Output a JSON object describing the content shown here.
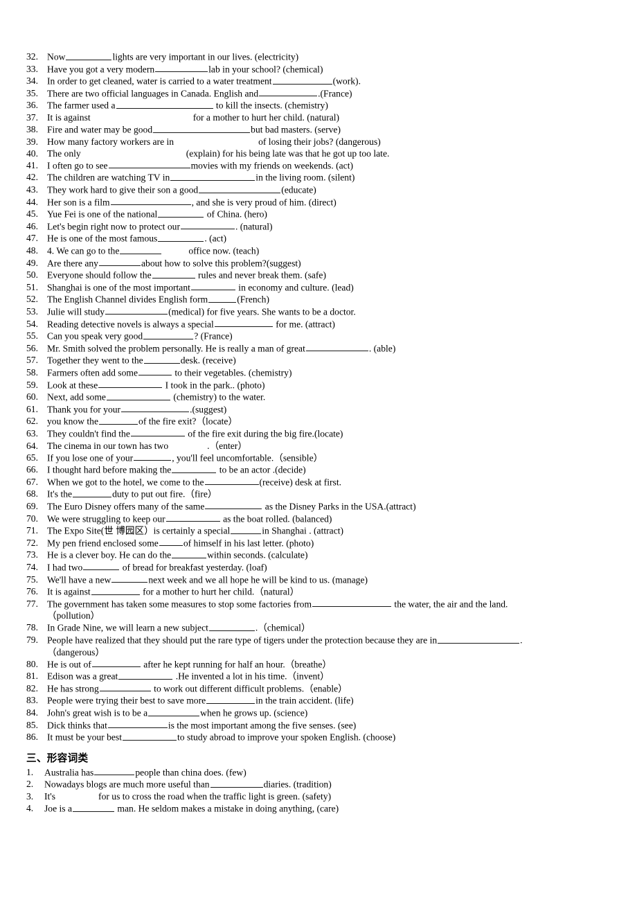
{
  "document": {
    "type": "worksheet",
    "language": "en-zh",
    "page_background": "#ffffff",
    "text_color": "#000000"
  },
  "exercises": [
    {
      "num": "32.",
      "pre": "Now",
      "blank": 66,
      "post": "lights are very important in our lives. (electricity)"
    },
    {
      "num": "33.",
      "pre": "Have you got a very modern",
      "blank": 76,
      "post": "lab in your school? (chemical)"
    },
    {
      "num": "34.",
      "pre": "In order to get cleaned, water is carried to a water treatment",
      "blank": 86,
      "post": "(work)."
    },
    {
      "num": "35.",
      "pre": "There are two official languages in Canada. English and",
      "blank": 84,
      "post": ".(France)"
    },
    {
      "num": "36.",
      "pre": "The farmer used a",
      "blank": 140,
      "post": " to kill the insects. (chemistry)"
    },
    {
      "num": "37.",
      "pre": "It is against",
      "blank": 0,
      "gap": 148,
      "post": "for a mother to hurt her child. (natural)"
    },
    {
      "num": "38.",
      "pre": "Fire and water may be good",
      "blank": 140,
      "post": "but bad masters. (serve)"
    },
    {
      "num": "39.",
      "pre": "How many factory workers are in",
      "blank": 0,
      "gap": 122,
      "post": "of losing their jobs? (dangerous)"
    },
    {
      "num": "40.",
      "pre": "The only",
      "blank": 0,
      "gap": 152,
      "post": "(explain) for his being late was that he got up too late."
    },
    {
      "num": "41.",
      "pre": "I often go to see",
      "blank": 118,
      "post": "movies with my friends on weekends. (act)"
    },
    {
      "num": "42.",
      "pre": "The children are watching TV in",
      "blank": 122,
      "post": "in the living room. (silent)"
    },
    {
      "num": "43.",
      "pre": "They work hard to give their son a good",
      "blank": 118,
      "post": "(educate)"
    },
    {
      "num": "44.",
      "pre": "Her son is a film",
      "blank": 116,
      "post": ", and she is very proud of him. (direct)"
    },
    {
      "num": "45.",
      "pre": "Yue Fei is one of the national",
      "blank": 66,
      "post": " of China. (hero)"
    },
    {
      "num": "46.",
      "pre": "Let's begin right now to protect our",
      "blank": 78,
      "post": ". (natural)"
    },
    {
      "num": "47.",
      "pre": "He is one of the most famous",
      "blank": 66,
      "post": ". (act)"
    },
    {
      "num": "48.",
      "pre": "4. We can go to the",
      "blank": 60,
      "gap": 38,
      "post": "office now. (teach)"
    },
    {
      "num": "49.",
      "pre": "Are there any",
      "blank": 60,
      "post": "about how to solve this problem?(suggest)"
    },
    {
      "num": "50.",
      "pre": "Everyone should follow the",
      "blank": 62,
      "post": " rules and never break them. (safe)"
    },
    {
      "num": "51.",
      "pre": "Shanghai is one of the most important",
      "blank": 64,
      "post": " in economy and culture. (lead)"
    },
    {
      "num": "52.",
      "pre": "The English Channel divides English form",
      "blank": 40,
      "post": "(French)"
    },
    {
      "num": "53.",
      "pre": "Julie will study",
      "blank": 90,
      "post": "(medical) for five years. She wants to be a doctor."
    },
    {
      "num": "54.",
      "pre": "Reading detective novels is always a special",
      "blank": 84,
      "post": " for me. (attract)"
    },
    {
      "num": "55.",
      "pre": "Can you speak very good",
      "blank": 72,
      "post": "? (France)"
    },
    {
      "num": "56.",
      "pre": "Mr. Smith solved the problem personally. He is really a man of great",
      "blank": 90,
      "post": ". (able)"
    },
    {
      "num": "57.",
      "pre": "Together they went to the",
      "blank": 52,
      "post": "desk. (receive)"
    },
    {
      "num": "58.",
      "pre": "Farmers often add some",
      "blank": 48,
      "post": " to their vegetables. (chemistry)"
    },
    {
      "num": "59.",
      "pre": "Look at these",
      "blank": 92,
      "post": " I took in the park.. (photo)"
    },
    {
      "num": "60.",
      "pre": "Next, add some",
      "blank": 92,
      "post": " (chemistry) to the water."
    },
    {
      "num": "61.",
      "pre": "Thank you for your",
      "blank": 98,
      "post": ".(suggest)"
    },
    {
      "num": "62.",
      "pre": "you know the",
      "blank": 56,
      "post": "of the fire exit?（locate）"
    },
    {
      "num": "63.",
      "pre": "They couldn't find the",
      "blank": 78,
      "post": " of the fire exit during the big fire.(locate)"
    },
    {
      "num": "64.",
      "pre": "The cinema in our town has two",
      "blank": 0,
      "gap": 56,
      "post": ".（enter）"
    },
    {
      "num": "65.",
      "pre": "If you lose one of your",
      "blank": 54,
      "post": ", you'll feel uncomfortable.（sensible）"
    },
    {
      "num": "66.",
      "pre": "I thought hard before making the",
      "blank": 64,
      "post": " to be an actor .(decide)"
    },
    {
      "num": "67.",
      "pre": "When we got to the hotel, we come to the",
      "blank": 78,
      "post": "(receive) desk at first."
    },
    {
      "num": "68.",
      "pre": "It's the",
      "blank": 56,
      "post": "duty to put out fire.（fire）"
    },
    {
      "num": "69.",
      "pre": "The Euro Disney offers many of the same",
      "blank": 82,
      "post": " as the Disney Parks in the USA.(attract)"
    },
    {
      "num": "70.",
      "pre": "We were struggling to keep our",
      "blank": 78,
      "post": " as the boat rolled. (balanced)"
    },
    {
      "num": "71.",
      "pre": "The Expo Site(世 博园区）is certainly a special",
      "blank": 44,
      "post": "in Shanghai . (attract)"
    },
    {
      "num": "72.",
      "pre": "My pen friend enclosed some",
      "blank": 34,
      "post": "of himself in his last letter. (photo)"
    },
    {
      "num": "73.",
      "pre": "He is a clever boy. He can do the",
      "blank": 50,
      "post": "within seconds. (calculate)"
    },
    {
      "num": "74.",
      "pre": "I had two",
      "blank": 52,
      "post": " of bread for breakfast yesterday. (loaf)"
    },
    {
      "num": "75.",
      "pre": "We'll have a new",
      "blank": 52,
      "post": "next week and we all hope he will be kind to us. (manage)"
    },
    {
      "num": "76.",
      "pre": "It is against",
      "blank": 70,
      "post": " for a mother to hurt her child.（natural）"
    },
    {
      "num": "77.",
      "pre": "The government has taken some measures to stop some factories from",
      "blank": 114,
      "post": " the water, the air and the land.",
      "cont": "（pollution）"
    },
    {
      "num": "78.",
      "pre": "In Grade Nine, we will learn a new subject",
      "blank": 66,
      "post": ".（chemical）"
    },
    {
      "num": "79.",
      "pre": "People have realized that they should put the rare type of tigers under the protection because they are in",
      "blank": 118,
      "post": ".",
      "cont": "（dangerous）"
    },
    {
      "num": "80.",
      "pre": "He is out of",
      "blank": 70,
      "post": " after he kept running for half an hour.（breathe）"
    },
    {
      "num": "81.",
      "pre": "Edison was a great",
      "blank": 78,
      "post": " .He invented a lot in his time.（invent）"
    },
    {
      "num": "82.",
      "pre": "He has strong",
      "blank": 74,
      "post": " to work out different difficult problems.（enable）"
    },
    {
      "num": "83.",
      "pre": "People were trying their best to save more",
      "blank": 70,
      "post": "in the train accident. (life)"
    },
    {
      "num": "84.",
      "pre": "John's great wish is to be a",
      "blank": 74,
      "post": "when he grows up. (science)"
    },
    {
      "num": "85.",
      "pre": "Dick thinks that",
      "blank": 86,
      "post": "is the most important among the five senses. (see)"
    },
    {
      "num": "86.",
      "pre": "It must be your best",
      "blank": 78,
      "post": "to study abroad to improve your spoken English. (choose)"
    }
  ],
  "section_heading": "三、形容词类",
  "adjective_exercises": [
    {
      "num": "1.",
      "pre": "Australia has",
      "blank": 58,
      "post": "people than china does. (few)"
    },
    {
      "num": "2.",
      "pre": "Nowadays blogs are much more useful than",
      "blank": 76,
      "post": "diaries. (tradition)"
    },
    {
      "num": "3.",
      "pre": "It's",
      "blank": 0,
      "gap": 62,
      "post": "for us to cross the road when the traffic light is green. (safety)"
    },
    {
      "num": "4.",
      "pre": "Joe is a",
      "blank": 60,
      "post": " man. He seldom makes a mistake in doing anything, (care)"
    }
  ]
}
